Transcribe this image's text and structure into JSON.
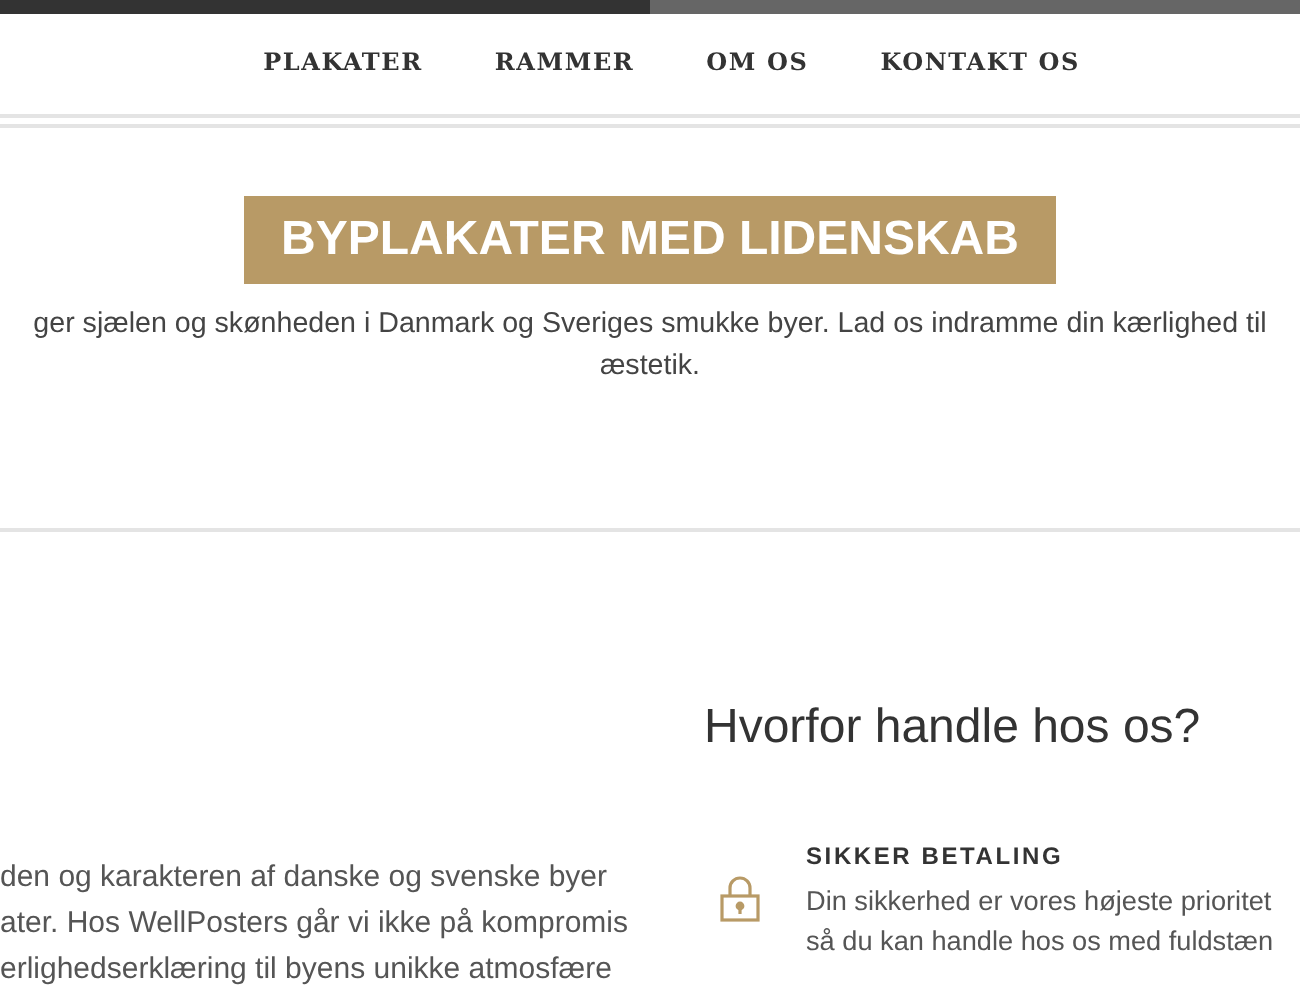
{
  "nav": {
    "items": [
      "PLAKATER",
      "RAMMER",
      "OM OS",
      "KONTAKT OS"
    ]
  },
  "hero": {
    "title": "BYPLAKATER MED LIDENSKAB",
    "text_lines": [
      "ger sjælen og skønheden i Danmark og Sveriges smukke byer. Lad os indramme din kærlighed til",
      "æstetik."
    ]
  },
  "about": {
    "text_lines": [
      "den og karakteren af danske og svenske byer",
      "ater. Hos WellPosters går vi ikke på kompromis",
      "erlighedserklæring til byens unikke atmosfære"
    ]
  },
  "why": {
    "heading": "Hvorfor handle hos os?",
    "features": [
      {
        "kind": "lock",
        "title": "SIKKER BETALING",
        "text_lines": [
          "Din sikkerhed er vores højeste prioritet",
          "så du kan handle hos os med fuldstæn"
        ]
      }
    ]
  }
}
